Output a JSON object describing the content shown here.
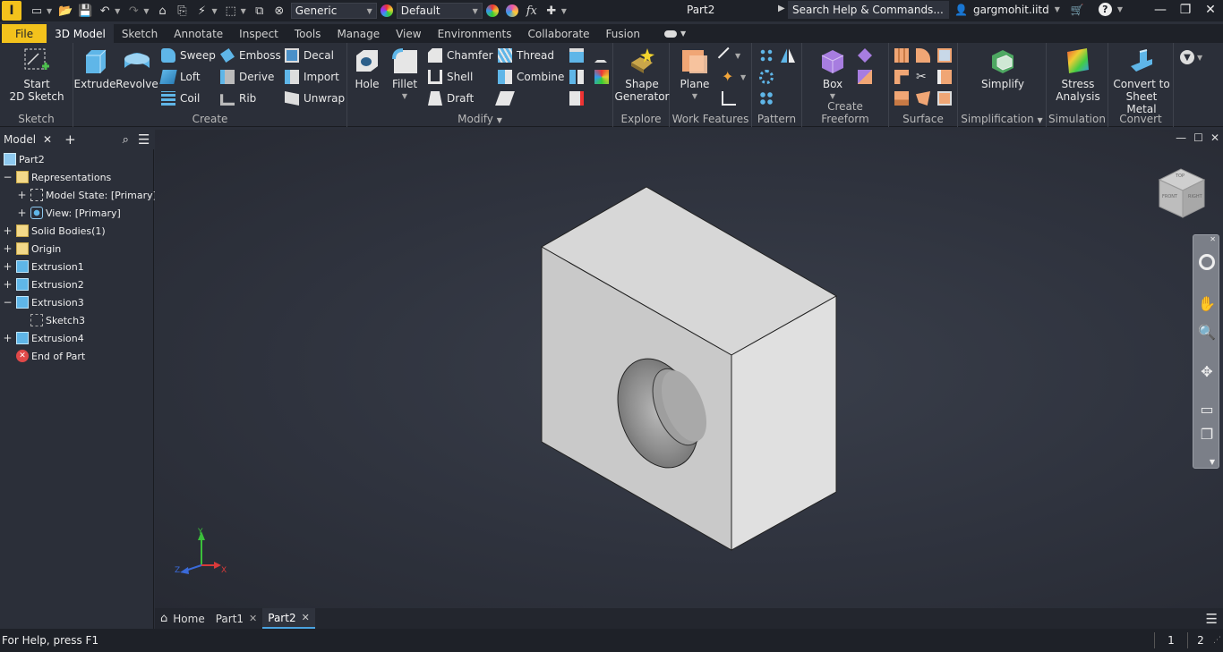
{
  "qat": {
    "logo_letter": "I",
    "appearance_combo": "Generic",
    "material_combo": "Default",
    "fx_label": "fx",
    "document_title": "Part2",
    "search_placeholder": "Search Help & Commands...",
    "username": "gargmohit.iitd"
  },
  "tabs": [
    "File",
    "3D Model",
    "Sketch",
    "Annotate",
    "Inspect",
    "Tools",
    "Manage",
    "View",
    "Environments",
    "Collaborate",
    "Fusion"
  ],
  "ribbon": {
    "sketch": {
      "label": "Sketch",
      "start_sketch": "Start\n2D Sketch",
      "start_sketch_l1": "Start",
      "start_sketch_l2": "2D Sketch"
    },
    "create": {
      "label": "Create",
      "extrude": "Extrude",
      "revolve": "Revolve",
      "sweep": "Sweep",
      "loft": "Loft",
      "coil": "Coil",
      "emboss": "Emboss",
      "derive": "Derive",
      "rib": "Rib",
      "decal": "Decal",
      "import": "Import",
      "unwrap": "Unwrap"
    },
    "modify": {
      "label": "Modify",
      "hole": "Hole",
      "fillet": "Fillet",
      "chamfer": "Chamfer",
      "shell": "Shell",
      "draft": "Draft",
      "thread": "Thread",
      "combine": "Combine"
    },
    "explore": {
      "label": "Explore",
      "shape_gen_l1": "Shape",
      "shape_gen_l2": "Generator"
    },
    "work_features": {
      "label": "Work Features",
      "plane": "Plane"
    },
    "pattern": {
      "label": "Pattern"
    },
    "freeform": {
      "label": "Create Freeform",
      "box": "Box"
    },
    "surface": {
      "label": "Surface"
    },
    "simplification": {
      "label": "Simplification",
      "simplify": "Simplify"
    },
    "simulation": {
      "label": "Simulation",
      "stress_l1": "Stress",
      "stress_l2": "Analysis"
    },
    "convert": {
      "label": "Convert",
      "sheet_l1": "Convert to",
      "sheet_l2": "Sheet Metal"
    }
  },
  "browser": {
    "tab_label": "Model",
    "tree": [
      {
        "label": "Part2"
      },
      {
        "label": "Representations"
      },
      {
        "label": "Model State: [Primary]"
      },
      {
        "label": "View: [Primary]"
      },
      {
        "label": "Solid Bodies(1)"
      },
      {
        "label": "Origin"
      },
      {
        "label": "Extrusion1"
      },
      {
        "label": "Extrusion2"
      },
      {
        "label": "Extrusion3"
      },
      {
        "label": "Sketch3"
      },
      {
        "label": "Extrusion4"
      },
      {
        "label": "End of Part"
      }
    ]
  },
  "viewcube": {
    "face_top": "TOP",
    "face_front": "FRONT",
    "face_right": "RIGHT"
  },
  "triad": {
    "x": "X",
    "y": "Y",
    "z": "Z"
  },
  "doc_tabs": {
    "home": "Home",
    "part1": "Part1",
    "part2": "Part2"
  },
  "status": {
    "help": "For Help, press F1",
    "count1": "1",
    "count2": "2"
  },
  "colors": {
    "accent_file": "#f3c21c",
    "active_tab_underline": "#4aa3e0",
    "background": "#2b2f39",
    "part_face": "#d7d7d7"
  }
}
